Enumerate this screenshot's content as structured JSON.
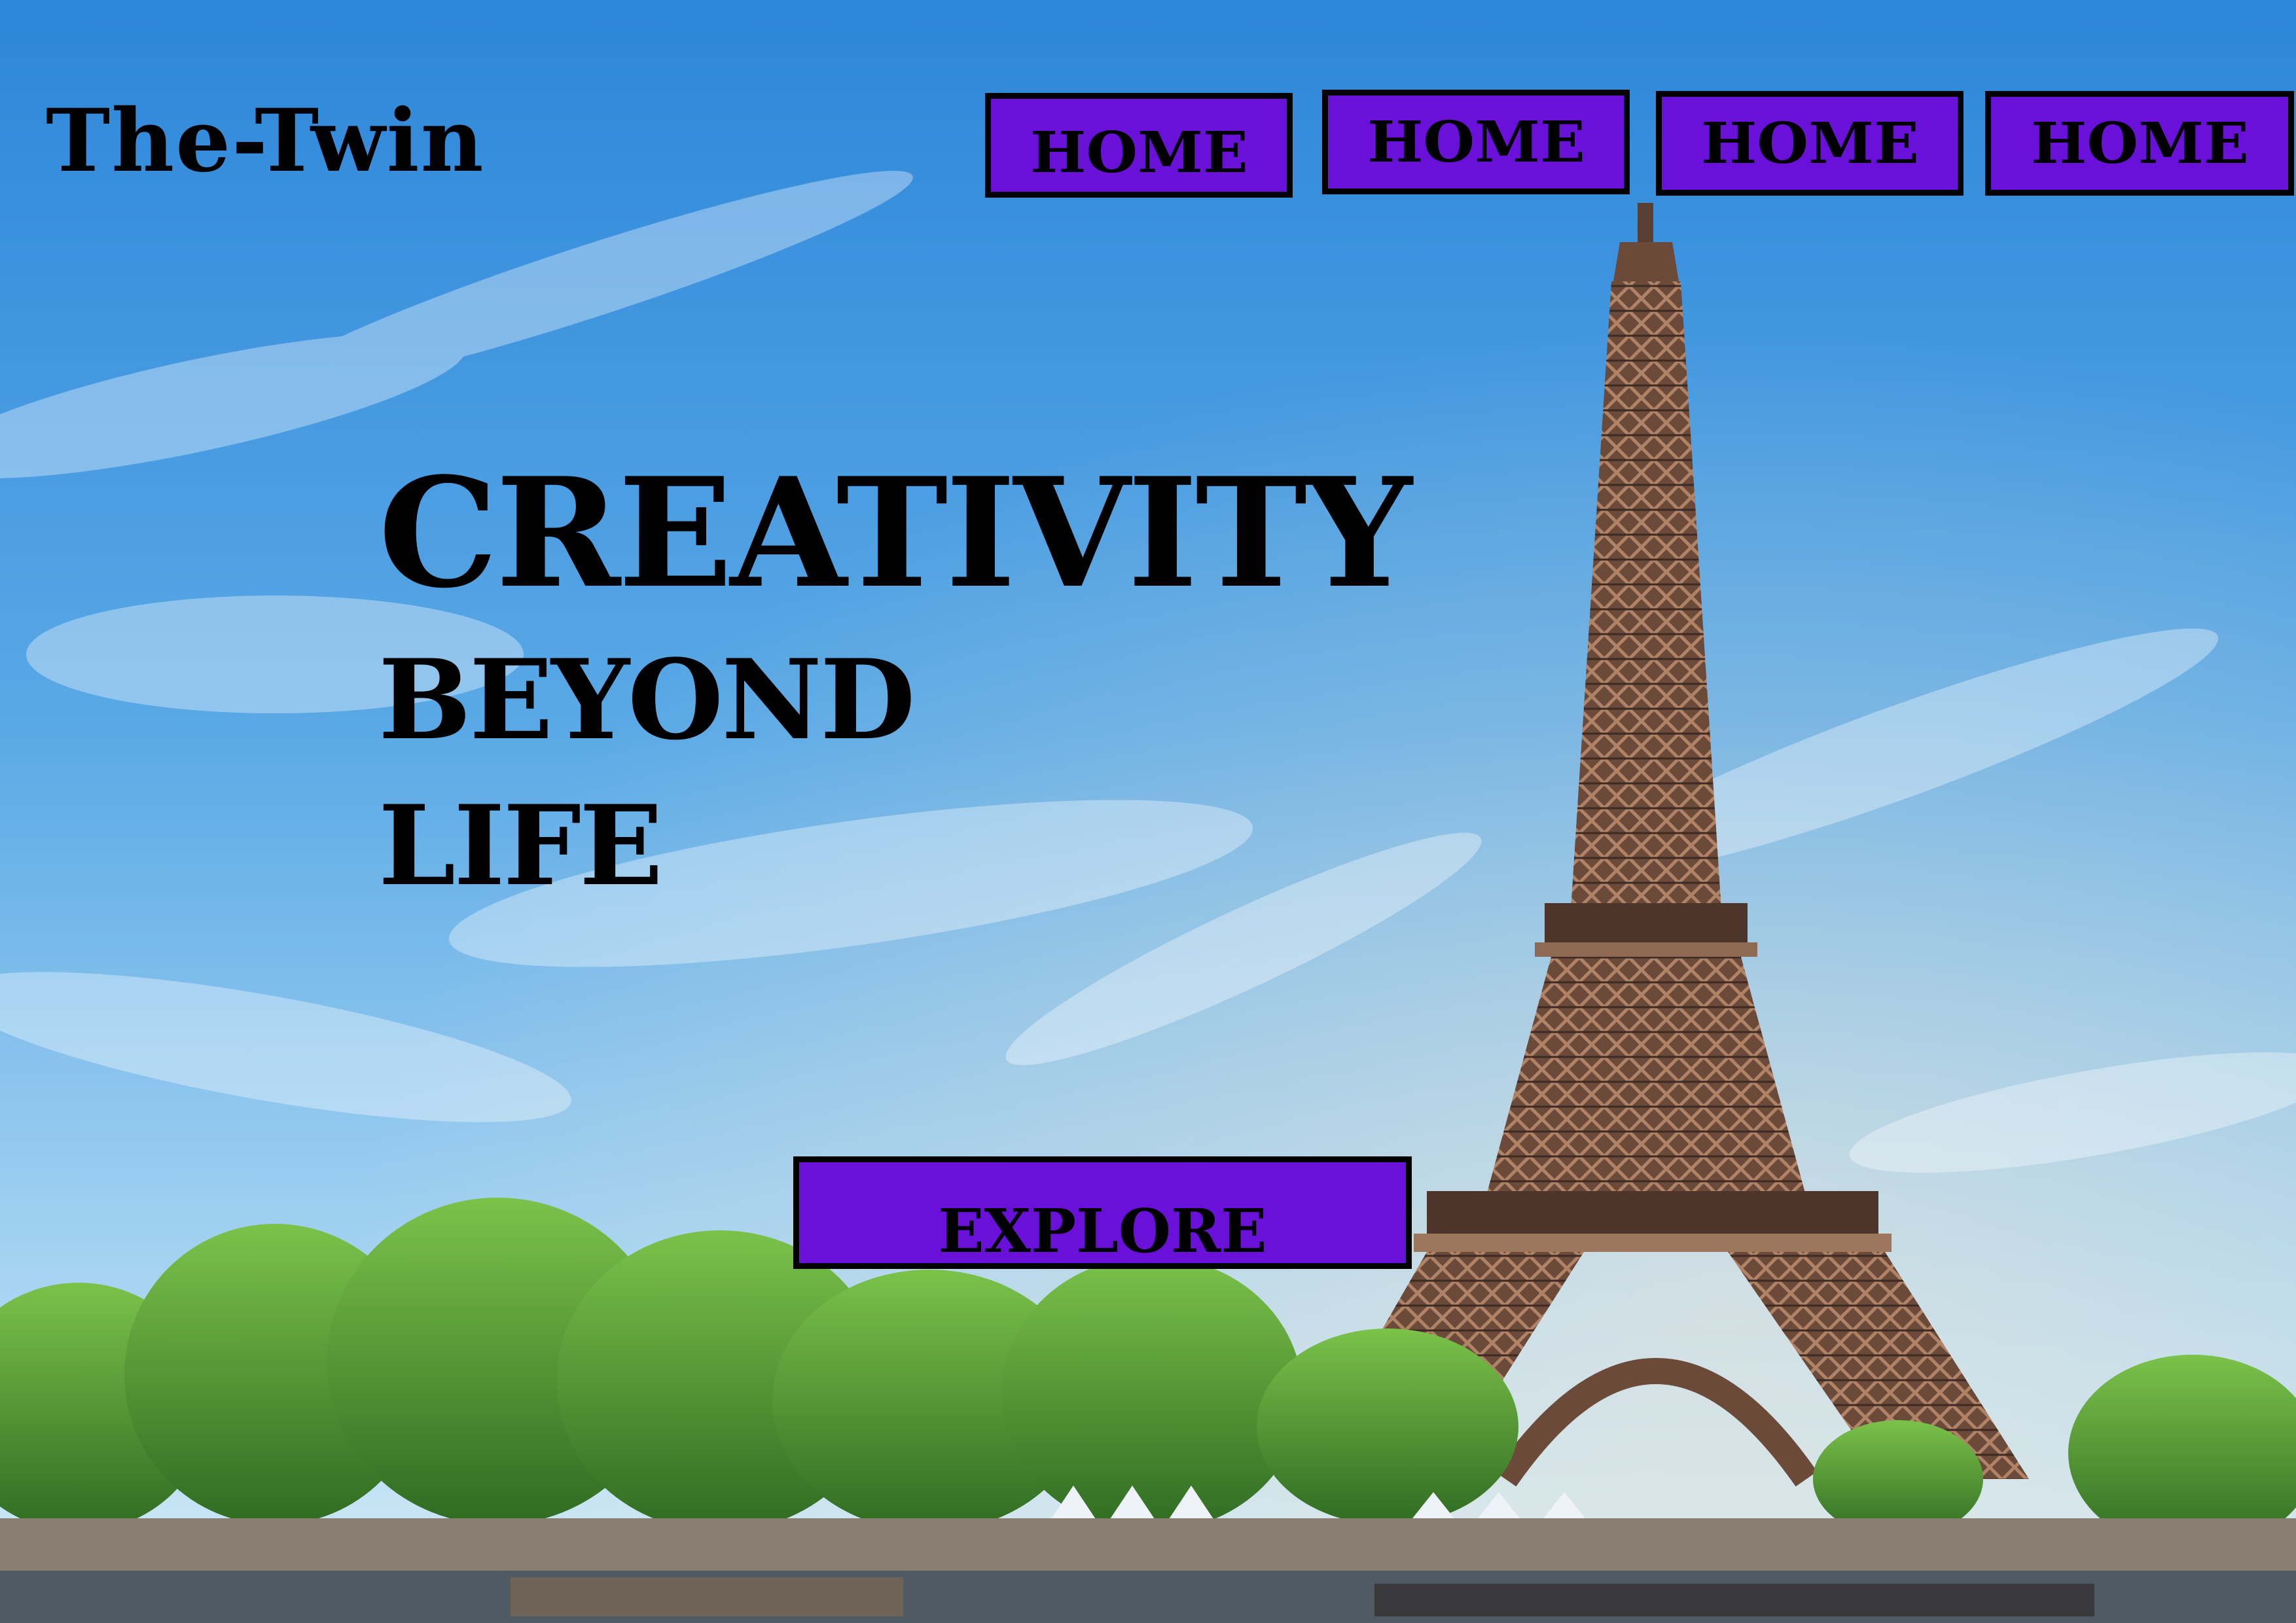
{
  "brand": {
    "name": "The-Twin"
  },
  "nav": {
    "items": [
      {
        "label": "HOME"
      },
      {
        "label": "HOME"
      },
      {
        "label": "HOME"
      },
      {
        "label": "HOME"
      }
    ]
  },
  "hero": {
    "line1": "CREATIVITY",
    "line2": "BEYOND",
    "line3": "LIFE"
  },
  "cta": {
    "label": "EXPLORE"
  },
  "colors": {
    "button_fill": "#6A11D9",
    "text": "#000000",
    "sky_top": "#2E86D8",
    "sky_bottom": "#BFE2F4"
  },
  "background": {
    "subject": "eiffel-tower-photo"
  }
}
